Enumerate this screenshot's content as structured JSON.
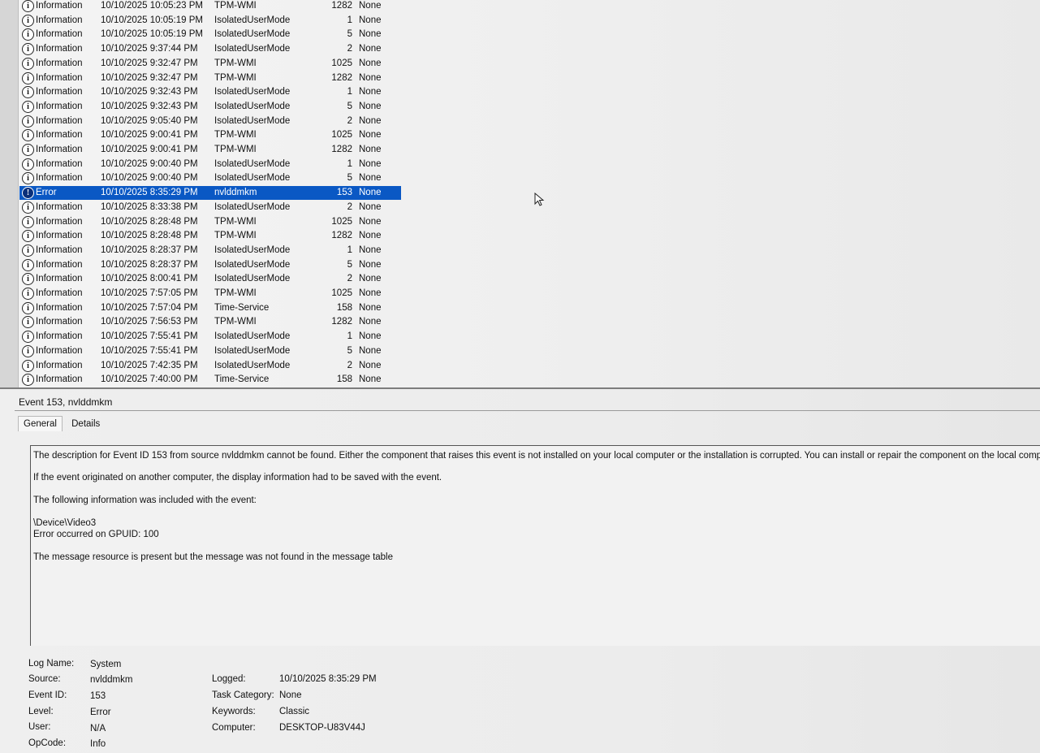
{
  "events": [
    {
      "level": "Information",
      "date": "10/10/2025 10:05:23 PM",
      "source": "TPM-WMI",
      "event_id": "1282",
      "task": "None"
    },
    {
      "level": "Information",
      "date": "10/10/2025 10:05:19 PM",
      "source": "IsolatedUserMode",
      "event_id": "1",
      "task": "None"
    },
    {
      "level": "Information",
      "date": "10/10/2025 10:05:19 PM",
      "source": "IsolatedUserMode",
      "event_id": "5",
      "task": "None"
    },
    {
      "level": "Information",
      "date": "10/10/2025 9:37:44 PM",
      "source": "IsolatedUserMode",
      "event_id": "2",
      "task": "None"
    },
    {
      "level": "Information",
      "date": "10/10/2025 9:32:47 PM",
      "source": "TPM-WMI",
      "event_id": "1025",
      "task": "None"
    },
    {
      "level": "Information",
      "date": "10/10/2025 9:32:47 PM",
      "source": "TPM-WMI",
      "event_id": "1282",
      "task": "None"
    },
    {
      "level": "Information",
      "date": "10/10/2025 9:32:43 PM",
      "source": "IsolatedUserMode",
      "event_id": "1",
      "task": "None"
    },
    {
      "level": "Information",
      "date": "10/10/2025 9:32:43 PM",
      "source": "IsolatedUserMode",
      "event_id": "5",
      "task": "None"
    },
    {
      "level": "Information",
      "date": "10/10/2025 9:05:40 PM",
      "source": "IsolatedUserMode",
      "event_id": "2",
      "task": "None"
    },
    {
      "level": "Information",
      "date": "10/10/2025 9:00:41 PM",
      "source": "TPM-WMI",
      "event_id": "1025",
      "task": "None"
    },
    {
      "level": "Information",
      "date": "10/10/2025 9:00:41 PM",
      "source": "TPM-WMI",
      "event_id": "1282",
      "task": "None"
    },
    {
      "level": "Information",
      "date": "10/10/2025 9:00:40 PM",
      "source": "IsolatedUserMode",
      "event_id": "1",
      "task": "None"
    },
    {
      "level": "Information",
      "date": "10/10/2025 9:00:40 PM",
      "source": "IsolatedUserMode",
      "event_id": "5",
      "task": "None"
    },
    {
      "level": "Error",
      "date": "10/10/2025 8:35:29 PM",
      "source": "nvlddmkm",
      "event_id": "153",
      "task": "None",
      "selected": true
    },
    {
      "level": "Information",
      "date": "10/10/2025 8:33:38 PM",
      "source": "IsolatedUserMode",
      "event_id": "2",
      "task": "None"
    },
    {
      "level": "Information",
      "date": "10/10/2025 8:28:48 PM",
      "source": "TPM-WMI",
      "event_id": "1025",
      "task": "None"
    },
    {
      "level": "Information",
      "date": "10/10/2025 8:28:48 PM",
      "source": "TPM-WMI",
      "event_id": "1282",
      "task": "None"
    },
    {
      "level": "Information",
      "date": "10/10/2025 8:28:37 PM",
      "source": "IsolatedUserMode",
      "event_id": "1",
      "task": "None"
    },
    {
      "level": "Information",
      "date": "10/10/2025 8:28:37 PM",
      "source": "IsolatedUserMode",
      "event_id": "5",
      "task": "None"
    },
    {
      "level": "Information",
      "date": "10/10/2025 8:00:41 PM",
      "source": "IsolatedUserMode",
      "event_id": "2",
      "task": "None"
    },
    {
      "level": "Information",
      "date": "10/10/2025 7:57:05 PM",
      "source": "TPM-WMI",
      "event_id": "1025",
      "task": "None"
    },
    {
      "level": "Information",
      "date": "10/10/2025 7:57:04 PM",
      "source": "Time-Service",
      "event_id": "158",
      "task": "None"
    },
    {
      "level": "Information",
      "date": "10/10/2025 7:56:53 PM",
      "source": "TPM-WMI",
      "event_id": "1282",
      "task": "None"
    },
    {
      "level": "Information",
      "date": "10/10/2025 7:55:41 PM",
      "source": "IsolatedUserMode",
      "event_id": "1",
      "task": "None"
    },
    {
      "level": "Information",
      "date": "10/10/2025 7:55:41 PM",
      "source": "IsolatedUserMode",
      "event_id": "5",
      "task": "None"
    },
    {
      "level": "Information",
      "date": "10/10/2025 7:42:35 PM",
      "source": "IsolatedUserMode",
      "event_id": "2",
      "task": "None"
    },
    {
      "level": "Information",
      "date": "10/10/2025 7:40:00 PM",
      "source": "Time-Service",
      "event_id": "158",
      "task": "None"
    }
  ],
  "detail": {
    "header": "Event 153, nvlddmkm",
    "tabs": {
      "general": "General",
      "details": "Details"
    },
    "description": {
      "line1": "The description for Event ID 153 from source nvlddmkm cannot be found. Either the component that raises this event is not installed on your local computer or the installation is corrupted. You can install or repair the component on the local computer.",
      "line2": "If the event originated on another computer, the display information had to be saved with the event.",
      "line3": "The following information was included with the event:",
      "line4": "\\Device\\Video3",
      "line5": "Error occurred on GPUID: 100",
      "line6": "The message resource is present but the message was not found in the message table"
    },
    "properties": {
      "log_name_label": "Log Name:",
      "log_name": "System",
      "source_label": "Source:",
      "source": "nvlddmkm",
      "event_id_label": "Event ID:",
      "event_id": "153",
      "level_label": "Level:",
      "level": "Error",
      "user_label": "User:",
      "user": "N/A",
      "opcode_label": "OpCode:",
      "opcode": "Info",
      "logged_label": "Logged:",
      "logged": "10/10/2025 8:35:29 PM",
      "task_category_label": "Task Category:",
      "task_category": "None",
      "keywords_label": "Keywords:",
      "keywords": "Classic",
      "computer_label": "Computer:",
      "computer": "DESKTOP-U83V44J"
    }
  },
  "icons": {
    "info": "info-circle-icon",
    "error": "error-circle-icon",
    "cursor": "mouse-pointer-icon"
  },
  "colors": {
    "selection": "#0a58c4"
  }
}
